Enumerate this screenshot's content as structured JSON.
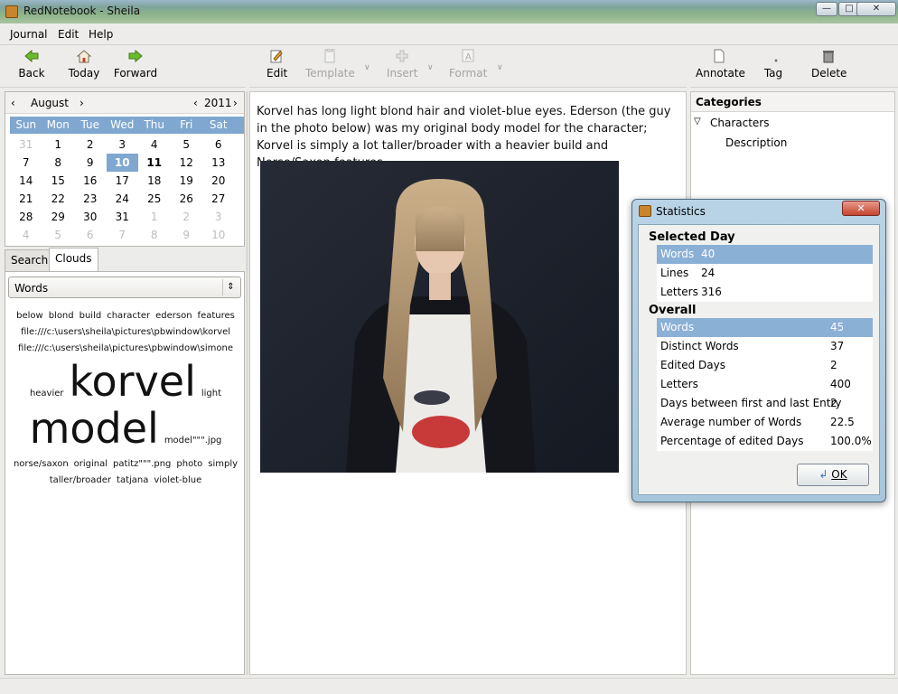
{
  "window": {
    "title": "RedNotebook - Sheila"
  },
  "menu": [
    "Journal",
    "Edit",
    "Help"
  ],
  "nav_toolbar": {
    "back": "Back",
    "today": "Today",
    "forward": "Forward"
  },
  "edit_toolbar": {
    "edit": "Edit",
    "template": "Template",
    "insert": "Insert",
    "format": "Format"
  },
  "right_toolbar": {
    "annotate": "Annotate",
    "tag": "Tag",
    "delete": "Delete"
  },
  "calendar": {
    "month": "August",
    "year": "2011",
    "days_of_week": [
      "Sun",
      "Mon",
      "Tue",
      "Wed",
      "Thu",
      "Fri",
      "Sat"
    ],
    "days": [
      {
        "d": "31",
        "m": true
      },
      {
        "d": "1"
      },
      {
        "d": "2"
      },
      {
        "d": "3"
      },
      {
        "d": "4"
      },
      {
        "d": "5"
      },
      {
        "d": "6"
      },
      {
        "d": "7"
      },
      {
        "d": "8"
      },
      {
        "d": "9"
      },
      {
        "d": "10",
        "sel": true
      },
      {
        "d": "11",
        "b": true
      },
      {
        "d": "12"
      },
      {
        "d": "13"
      },
      {
        "d": "14"
      },
      {
        "d": "15"
      },
      {
        "d": "16"
      },
      {
        "d": "17"
      },
      {
        "d": "18"
      },
      {
        "d": "19"
      },
      {
        "d": "20"
      },
      {
        "d": "21"
      },
      {
        "d": "22"
      },
      {
        "d": "23"
      },
      {
        "d": "24"
      },
      {
        "d": "25"
      },
      {
        "d": "26"
      },
      {
        "d": "27"
      },
      {
        "d": "28"
      },
      {
        "d": "29"
      },
      {
        "d": "30"
      },
      {
        "d": "31"
      },
      {
        "d": "1",
        "m": true
      },
      {
        "d": "2",
        "m": true
      },
      {
        "d": "3",
        "m": true
      },
      {
        "d": "4",
        "m": true
      },
      {
        "d": "5",
        "m": true
      },
      {
        "d": "6",
        "m": true
      },
      {
        "d": "7",
        "m": true
      },
      {
        "d": "8",
        "m": true
      },
      {
        "d": "9",
        "m": true
      },
      {
        "d": "10",
        "m": true
      }
    ]
  },
  "tabs": {
    "search": "Search",
    "clouds": "Clouds"
  },
  "cloud": {
    "selector": "Words",
    "lines": [
      [
        {
          "w": "below",
          "s": 10
        },
        {
          "w": "blond",
          "s": 10
        },
        {
          "w": "build",
          "s": 10
        },
        {
          "w": "character",
          "s": 10
        },
        {
          "w": "ederson",
          "s": 10
        },
        {
          "w": "features",
          "s": 10
        }
      ],
      [
        {
          "w": "file:///c:\\users\\sheila\\pictures\\pbwindow\\korvel",
          "s": 10
        }
      ],
      [
        {
          "w": "file:///c:\\users\\sheila\\pictures\\pbwindow\\simone",
          "s": 10
        }
      ],
      [
        {
          "w": "heavier",
          "s": 10
        },
        {
          "w": "korvel",
          "s": 46
        },
        {
          "w": "light",
          "s": 10
        }
      ],
      [
        {
          "w": "model",
          "s": 46
        },
        {
          "w": "model\"\"\".jpg",
          "s": 10
        }
      ],
      [
        {
          "w": "norse/saxon",
          "s": 10
        },
        {
          "w": "original",
          "s": 10
        },
        {
          "w": "patitz\"\"\".png",
          "s": 10
        },
        {
          "w": "photo",
          "s": 10
        },
        {
          "w": "simply",
          "s": 10
        }
      ],
      [
        {
          "w": "taller/broader",
          "s": 10
        },
        {
          "w": "tatjana",
          "s": 10
        },
        {
          "w": "violet-blue",
          "s": 10
        }
      ]
    ]
  },
  "entry": {
    "text": "Korvel has long light blond hair and violet-blue eyes. Ederson (the guy in the photo below) was my original body model for the character; Korvel is simply a lot taller/broader with a heavier build and Norse/Saxon features."
  },
  "categories": {
    "header": "Categories",
    "items": [
      "Characters",
      "Description"
    ]
  },
  "statistics": {
    "title": "Statistics",
    "selected_day_label": "Selected Day",
    "selected_day": [
      {
        "k": "Words",
        "v": "40"
      },
      {
        "k": "Lines",
        "v": "24"
      },
      {
        "k": "Letters",
        "v": "316"
      }
    ],
    "overall_label": "Overall",
    "overall": [
      {
        "k": "Words",
        "v": "45"
      },
      {
        "k": "Distinct Words",
        "v": "37"
      },
      {
        "k": "Edited Days",
        "v": "2"
      },
      {
        "k": "Letters",
        "v": "400"
      },
      {
        "k": "Days between first and last Entry",
        "v": "2"
      },
      {
        "k": "Average number of Words",
        "v": "22.5"
      },
      {
        "k": "Percentage of edited Days",
        "v": "100.0%"
      }
    ],
    "ok": "OK"
  }
}
